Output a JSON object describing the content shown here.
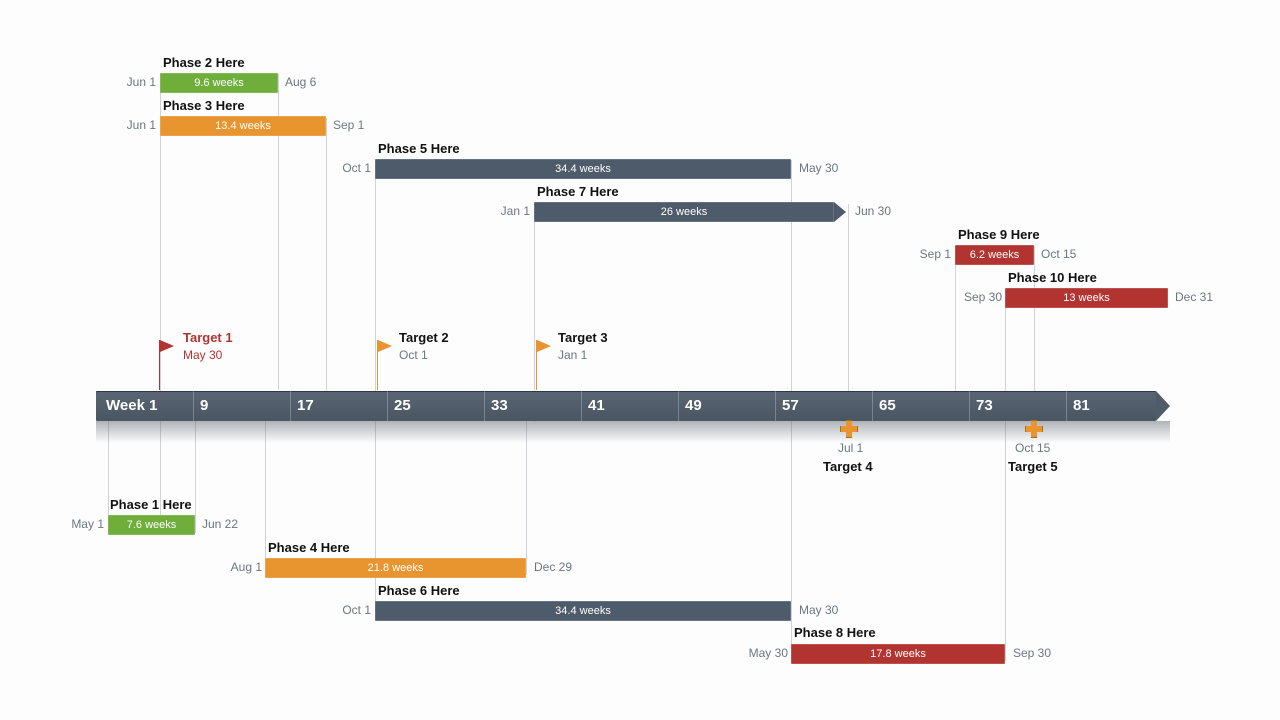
{
  "chart_data": {
    "type": "gantt",
    "title": "",
    "x_axis": {
      "unit": "weeks",
      "start": 1,
      "end": 88,
      "ticks": [
        1,
        9,
        17,
        25,
        33,
        41,
        49,
        57,
        65,
        73,
        81
      ],
      "tick_labels": [
        "Week 1",
        "9",
        "17",
        "25",
        "33",
        "41",
        "49",
        "57",
        "65",
        "73",
        "81"
      ]
    },
    "phases": [
      {
        "id": 1,
        "name": "Phase 1 Here",
        "start_date": "May 1",
        "end_date": "Jun 22",
        "duration": "7.6 weeks",
        "row": "below",
        "color": "green"
      },
      {
        "id": 2,
        "name": "Phase 2 Here",
        "start_date": "Jun 1",
        "end_date": "Aug 6",
        "duration": "9.6 weeks",
        "row": "above",
        "color": "green"
      },
      {
        "id": 3,
        "name": "Phase 3 Here",
        "start_date": "Jun 1",
        "end_date": "Sep 1",
        "duration": "13.4 weeks",
        "row": "above",
        "color": "orange"
      },
      {
        "id": 4,
        "name": "Phase 4 Here",
        "start_date": "Aug 1",
        "end_date": "Dec 29",
        "duration": "21.8 weeks",
        "row": "below",
        "color": "orange"
      },
      {
        "id": 5,
        "name": "Phase 5 Here",
        "start_date": "Oct 1",
        "end_date": "May 30",
        "duration": "34.4 weeks",
        "row": "above",
        "color": "slate"
      },
      {
        "id": 6,
        "name": "Phase 6 Here",
        "start_date": "Oct 1",
        "end_date": "May 30",
        "duration": "34.4 weeks",
        "row": "below",
        "color": "slate"
      },
      {
        "id": 7,
        "name": "Phase 7 Here",
        "start_date": "Jan 1",
        "end_date": "Jun 30",
        "duration": "26 weeks",
        "row": "above",
        "color": "slate",
        "pointed": true
      },
      {
        "id": 8,
        "name": "Phase 8 Here",
        "start_date": "May 30",
        "end_date": "Sep 30",
        "duration": "17.8 weeks",
        "row": "below",
        "color": "red"
      },
      {
        "id": 9,
        "name": "Phase 9 Here",
        "start_date": "Sep 1",
        "end_date": "Oct 15",
        "duration": "6.2 weeks",
        "row": "above",
        "color": "red"
      },
      {
        "id": 10,
        "name": "Phase 10 Here",
        "start_date": "Sep 30",
        "end_date": "Dec 31",
        "duration": "13 weeks",
        "row": "above",
        "color": "red"
      }
    ],
    "milestones": [
      {
        "id": 1,
        "name": "Target 1",
        "date": "May 30",
        "position": "above",
        "style": "flag",
        "color": "red"
      },
      {
        "id": 2,
        "name": "Target 2",
        "date": "Oct 1",
        "position": "above",
        "style": "flag",
        "color": "orange"
      },
      {
        "id": 3,
        "name": "Target 3",
        "date": "Jan 1",
        "position": "above",
        "style": "flag",
        "color": "orange"
      },
      {
        "id": 4,
        "name": "Target 4",
        "date": "Jul 1",
        "position": "below",
        "style": "cross",
        "color": "orange"
      },
      {
        "id": 5,
        "name": "Target 5",
        "date": "Oct 15",
        "position": "below",
        "style": "cross",
        "color": "orange"
      }
    ]
  },
  "axis": {
    "labels": [
      "Week 1",
      "9",
      "17",
      "25",
      "33",
      "41",
      "49",
      "57",
      "65",
      "73",
      "81"
    ]
  },
  "phases": {
    "p1": {
      "name": "Phase 1 Here",
      "dur": "7.6 weeks",
      "start": "May 1",
      "end": "Jun 22"
    },
    "p2": {
      "name": "Phase 2 Here",
      "dur": "9.6 weeks",
      "start": "Jun 1",
      "end": "Aug 6"
    },
    "p3": {
      "name": "Phase 3 Here",
      "dur": "13.4 weeks",
      "start": "Jun 1",
      "end": "Sep 1"
    },
    "p4": {
      "name": "Phase 4 Here",
      "dur": "21.8 weeks",
      "start": "Aug 1",
      "end": "Dec 29"
    },
    "p5": {
      "name": "Phase 5 Here",
      "dur": "34.4 weeks",
      "start": "Oct 1",
      "end": "May 30"
    },
    "p6": {
      "name": "Phase 6 Here",
      "dur": "34.4 weeks",
      "start": "Oct 1",
      "end": "May 30"
    },
    "p7": {
      "name": "Phase 7 Here",
      "dur": "26 weeks",
      "start": "Jan 1",
      "end": "Jun 30"
    },
    "p8": {
      "name": "Phase 8 Here",
      "dur": "17.8 weeks",
      "start": "May 30",
      "end": "Sep 30"
    },
    "p9": {
      "name": "Phase 9 Here",
      "dur": "6.2 weeks",
      "start": "Sep 1",
      "end": "Oct 15"
    },
    "p10": {
      "name": "Phase 10 Here",
      "dur": "13 weeks",
      "start": "Sep 30",
      "end": "Dec 31"
    }
  },
  "targets": {
    "t1": {
      "name": "Target 1",
      "date": "May 30"
    },
    "t2": {
      "name": "Target 2",
      "date": "Oct 1"
    },
    "t3": {
      "name": "Target 3",
      "date": "Jan 1"
    },
    "t4": {
      "name": "Target 4",
      "date": "Jul 1"
    },
    "t5": {
      "name": "Target 5",
      "date": "Oct 15"
    }
  }
}
